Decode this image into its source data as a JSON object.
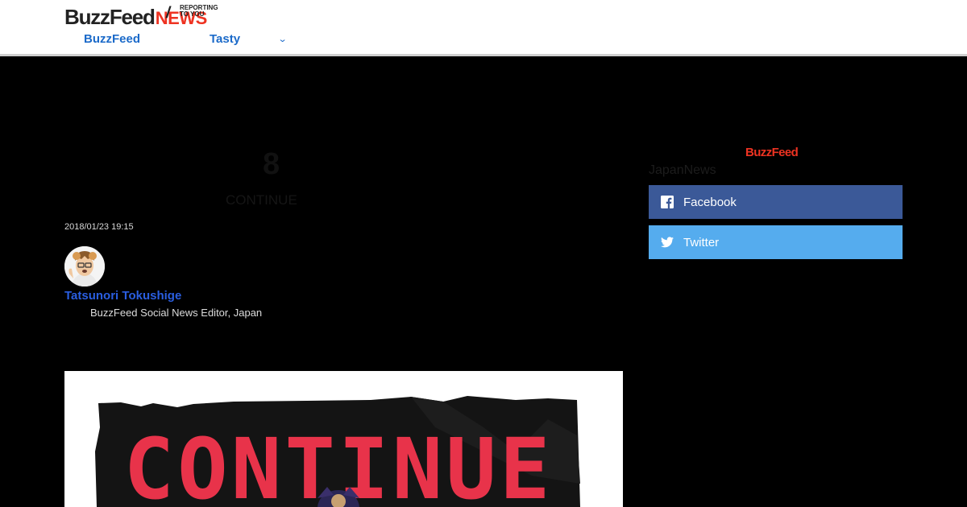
{
  "header": {
    "logo": {
      "buzzfeed": "BuzzFeed",
      "news": "NEWS",
      "tagline_line1": "REPORTING",
      "tagline_line2": "TO YOU"
    },
    "nav": {
      "buzzfeed": "BuzzFeed",
      "tasty": "Tasty"
    }
  },
  "article": {
    "count": "8",
    "count_label": "CONTINUE",
    "timestamp": "2018/01/23 19:15",
    "author": {
      "name": "Tatsunori Tokushige",
      "title": "BuzzFeed Social News Editor, Japan"
    },
    "hero_text": "CONTINUE"
  },
  "sidebar": {
    "brand": "BuzzFeed",
    "section": "JapanNews",
    "share": {
      "facebook": "Facebook",
      "twitter": "Twitter"
    }
  },
  "icons": {
    "nav_chevron": "chevron-down-icon",
    "facebook": "facebook-icon",
    "twitter": "twitter-icon",
    "avatar": "avatar-icon"
  },
  "colors": {
    "accent_blue": "#1b6ac9",
    "news_red": "#e32",
    "facebook": "#3b5998",
    "twitter": "#55acee",
    "author_link": "#2a5ee0"
  }
}
